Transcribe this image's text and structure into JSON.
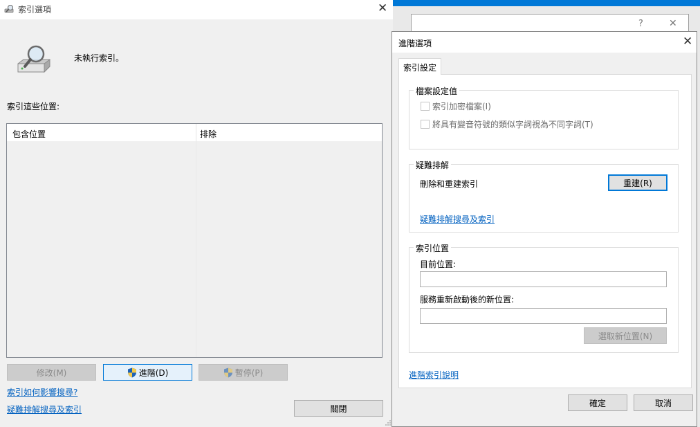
{
  "main_window": {
    "title": "索引選項",
    "status": "未執行索引。",
    "locations_label": "索引這些位置:",
    "columns": [
      "包含位置",
      "排除"
    ],
    "buttons": {
      "modify": "修改(M)",
      "advanced": "進階(D)",
      "pause": "暫停(P)",
      "close": "關閉"
    },
    "links": {
      "how_affects": "索引如何影響搜尋?",
      "troubleshoot": "疑難排解搜尋及索引"
    },
    "icons": {
      "app": "indexing-icon",
      "status": "drive-magnifier-icon",
      "shield": "uac-shield-icon"
    }
  },
  "background_window": {
    "help": "?",
    "close": "✕"
  },
  "advanced_dialog": {
    "title": "進階選項",
    "tab": "索引設定",
    "file_settings": {
      "label": "檔案設定值",
      "encrypt": "索引加密檔案(I)",
      "diacritics": "將具有變音符號的類似字詞視為不同字詞(T)"
    },
    "troubleshooting": {
      "label": "疑難排解",
      "rebuild_text": "刪除和重建索引",
      "rebuild_button": "重建(R)",
      "link": "疑難排解搜尋及索引"
    },
    "index_location": {
      "label": "索引位置",
      "current_label": "目前位置:",
      "current_value": "",
      "new_label": "服務重新啟動後的新位置:",
      "new_value": "",
      "select_button": "選取新位置(N)"
    },
    "help_link": "進階索引說明",
    "ok": "確定",
    "cancel": "取消"
  },
  "colors": {
    "accent": "#0078d7",
    "link": "#0563c1",
    "taskbar_blue": "#0078d7"
  }
}
